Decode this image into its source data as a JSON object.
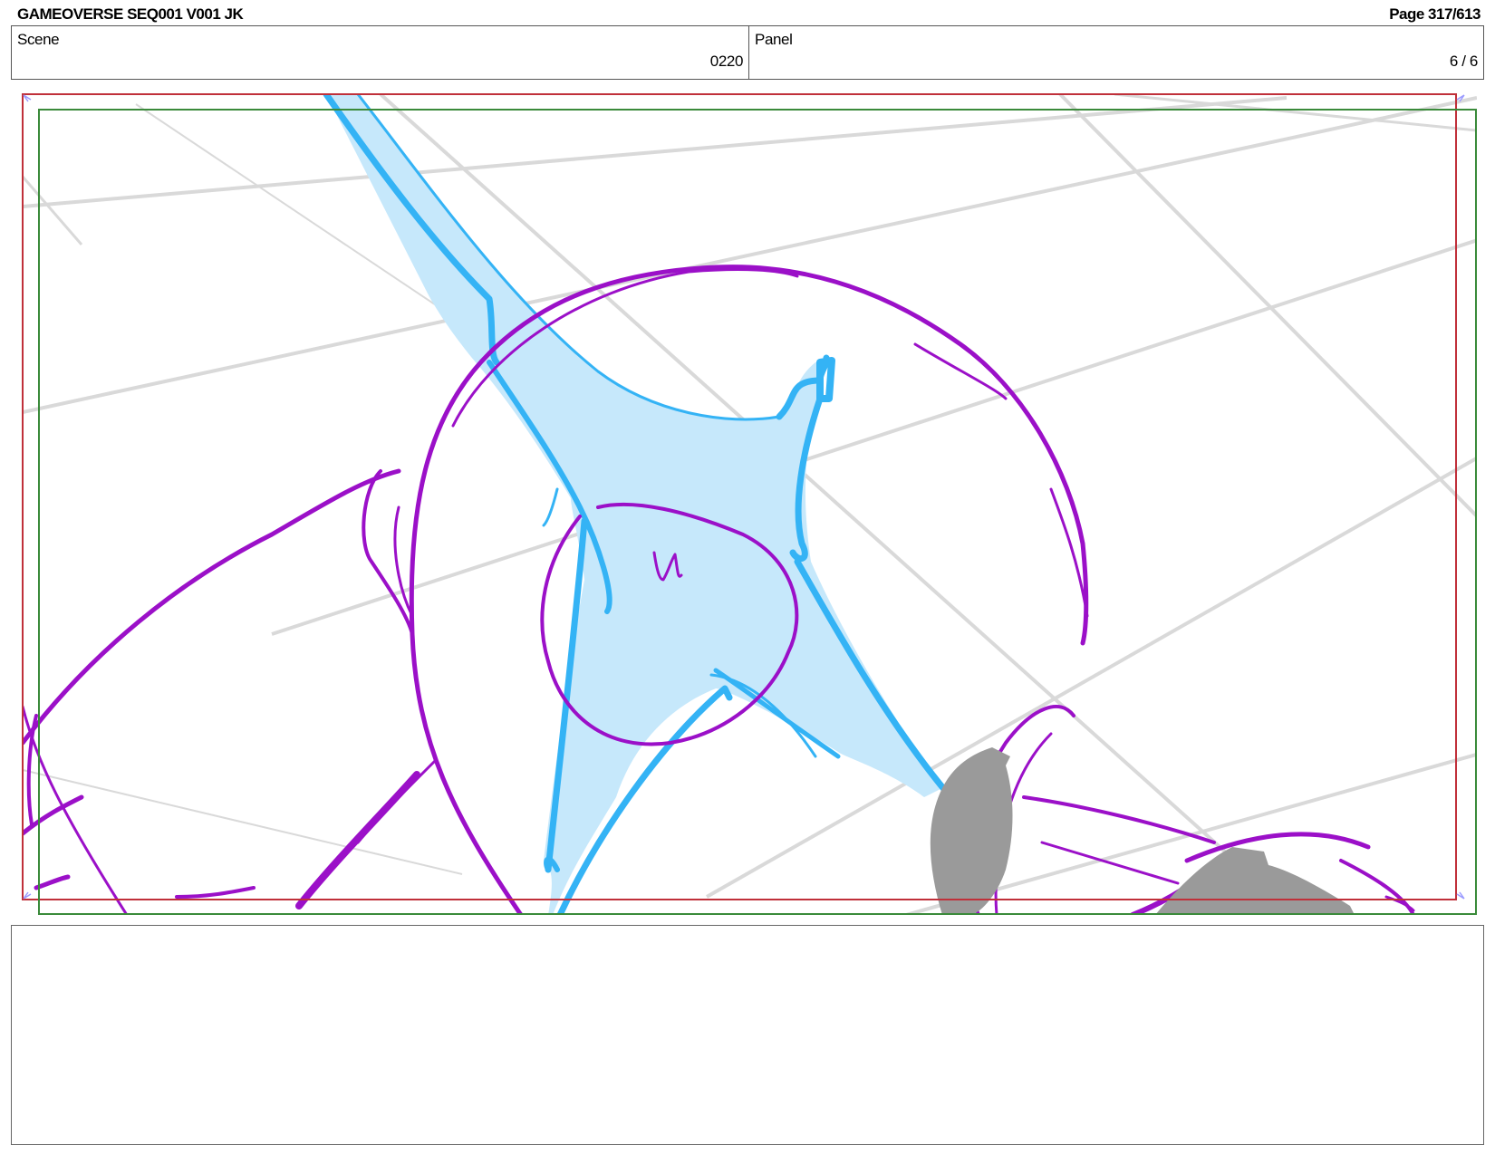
{
  "header": {
    "title": "GAMEOVERSE SEQ001 V001 JK",
    "page": "Page 317/613"
  },
  "info": {
    "scene_label": "Scene",
    "scene_value": "0220",
    "panel_label": "Panel",
    "panel_value": "6 / 6"
  },
  "colors": {
    "safe_frame": "#c0303a",
    "camera_frame": "#3a8a3a",
    "outline": "#9b10c8",
    "effect_line": "#34b3f5",
    "effect_fill": "#c6e8fb",
    "shadow": "#9a9a9a",
    "grid": "#d8d8d8"
  },
  "notes": {
    "text": ""
  }
}
